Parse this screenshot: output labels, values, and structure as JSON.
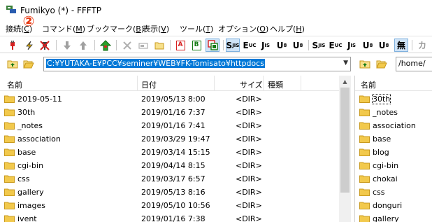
{
  "window": {
    "title": "Fumikyo (*) - FFFTP",
    "badge": "②"
  },
  "menu": [
    {
      "label": "接続(",
      "key": "C",
      "suffix": ")"
    },
    {
      "label": "コマンド(",
      "key": "M",
      "suffix": ")"
    },
    {
      "label": "ブックマーク(",
      "key": "B",
      "suffix": ")"
    },
    {
      "label": "表示(",
      "key": "V",
      "suffix": ")"
    },
    {
      "label": "ツール(",
      "key": "T",
      "suffix": ")"
    },
    {
      "label": "オプション(",
      "key": "O",
      "suffix": ")"
    },
    {
      "label": "ヘルプ(",
      "key": "H",
      "suffix": ")"
    }
  ],
  "toolbar": {
    "ascii_label": "A",
    "binary_label": "B",
    "kanji_buttons": [
      {
        "main": "S",
        "sub": "JIS"
      },
      {
        "main": "E",
        "sub": "UC"
      },
      {
        "main": "J",
        "sub": "IS"
      },
      {
        "main": "U",
        "sub": "8"
      },
      {
        "main": "U",
        "sub": "8"
      }
    ],
    "kanji_buttons_right": [
      {
        "main": "S",
        "sub": "JIS"
      },
      {
        "main": "E",
        "sub": "UC"
      },
      {
        "main": "J",
        "sub": "IS"
      },
      {
        "main": "U",
        "sub": "8"
      },
      {
        "main": "U",
        "sub": "8"
      }
    ],
    "none_label": "無",
    "kana_label": "カ"
  },
  "local": {
    "path": "C:¥YUTAKA-E¥PCC¥seminer¥WEB¥FK-Tomisato¥httpdocs",
    "columns": {
      "name": "名前",
      "date": "日付",
      "size": "サイズ",
      "type": "種類"
    },
    "files": [
      {
        "name": "2019-05-11",
        "date": "2019/05/13  8:00",
        "size": "<DIR>"
      },
      {
        "name": "30th",
        "date": "2019/01/16  7:37",
        "size": "<DIR>"
      },
      {
        "name": "_notes",
        "date": "2019/01/16  7:41",
        "size": "<DIR>"
      },
      {
        "name": "association",
        "date": "2019/03/29 19:47",
        "size": "<DIR>"
      },
      {
        "name": "base",
        "date": "2019/03/14 15:15",
        "size": "<DIR>"
      },
      {
        "name": "cgi-bin",
        "date": "2019/04/14  8:15",
        "size": "<DIR>"
      },
      {
        "name": "css",
        "date": "2019/03/17  6:57",
        "size": "<DIR>"
      },
      {
        "name": "gallery",
        "date": "2019/05/13  8:16",
        "size": "<DIR>"
      },
      {
        "name": "images",
        "date": "2019/05/10 10:56",
        "size": "<DIR>"
      },
      {
        "name": "ivent",
        "date": "2019/01/16  7:38",
        "size": "<DIR>"
      }
    ]
  },
  "remote": {
    "path": "/home/",
    "columns": {
      "name": "名前"
    },
    "files": [
      {
        "name": "30th"
      },
      {
        "name": "_notes"
      },
      {
        "name": "association"
      },
      {
        "name": "base"
      },
      {
        "name": "blog"
      },
      {
        "name": "cgi-bin"
      },
      {
        "name": "chokai"
      },
      {
        "name": "css"
      },
      {
        "name": "donguri"
      },
      {
        "name": "gallery"
      }
    ]
  },
  "colors": {
    "folder": "#f2c94c",
    "folder_edge": "#c99a1e",
    "selection": "#0078d7",
    "red": "#d62020",
    "green": "#2aa02a"
  }
}
